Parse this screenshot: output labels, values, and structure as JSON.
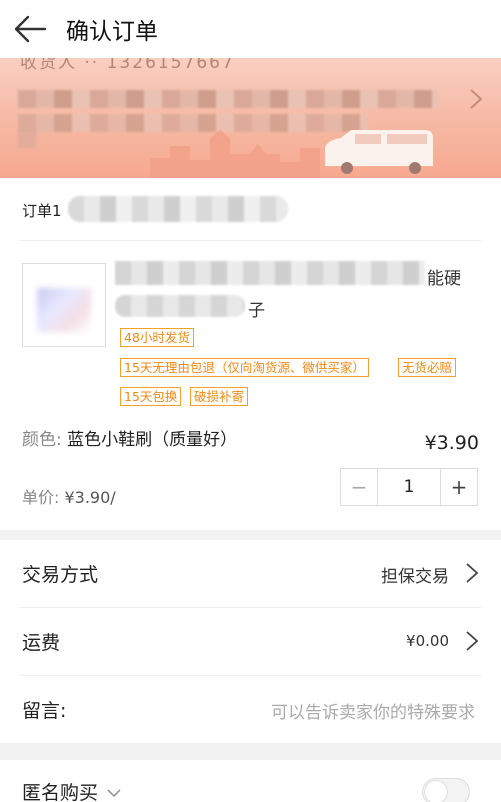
{
  "header": {
    "title": "确认订单"
  },
  "address": {
    "partial_top_text": "收货人 ·· 1326157667"
  },
  "order": {
    "id_label": "订单1",
    "product": {
      "name_tail_1": "能硬",
      "name_tail_2": "子",
      "tags": [
        "48小时发货",
        "15天无理由包退（仅向淘货源、微供买家）",
        "无货必赔",
        "15天包换",
        "破损补寄"
      ],
      "attr_key": "颜色: ",
      "attr_value": "蓝色小鞋刷（质量好）",
      "unit_key": "单价: ",
      "unit_value": "¥3.90/",
      "price": "¥3.90",
      "quantity": "1",
      "minus": "−",
      "plus": "+"
    }
  },
  "rows": {
    "trade": {
      "label": "交易方式",
      "value": "担保交易"
    },
    "shipping": {
      "label": "运费",
      "value": "¥0.00"
    },
    "message": {
      "label": "留言:",
      "placeholder": "可以告诉卖家你的特殊要求"
    }
  },
  "anon": {
    "label": "匿名购买"
  },
  "colors": {
    "accent": "#ee8a16",
    "banner": "#f6b8a3"
  }
}
